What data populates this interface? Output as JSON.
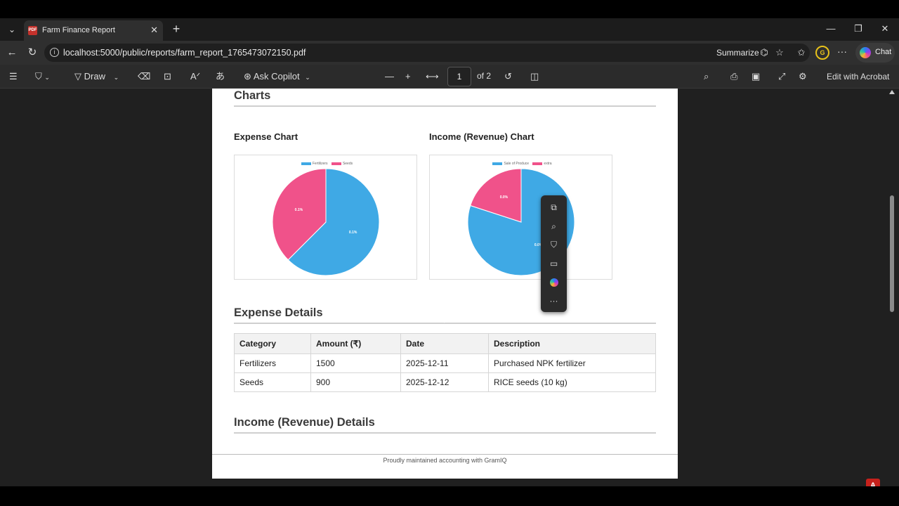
{
  "browser": {
    "tab_title": "Farm Finance Report",
    "favicon_text": "PDF",
    "url": "localhost:5000/public/reports/farm_report_1765473072150.pdf",
    "summarize_label": "Summarize",
    "profile_initials": "G",
    "chat_label": "Chat"
  },
  "pdf_toolbar": {
    "draw_label": "Draw",
    "ask_copilot_label": "Ask Copilot",
    "page_current": "1",
    "page_of": "of 2",
    "edit_acrobat_label": "Edit with Acrobat"
  },
  "report": {
    "charts_heading": "Charts",
    "expense_chart_title": "Expense Chart",
    "income_chart_title": "Income (Revenue) Chart",
    "expense_details_heading": "Expense Details",
    "income_details_heading": "Income (Revenue) Details",
    "footer": "Proudly maintained accounting with GramIQ",
    "table": {
      "headers": [
        "Category",
        "Amount (₹)",
        "Date",
        "Description"
      ],
      "rows": [
        [
          "Fertilizers",
          "1500",
          "2025-12-11",
          "Purchased NPK fertilizer"
        ],
        [
          "Seeds",
          "900",
          "2025-12-12",
          "RICE seeds (10 kg)"
        ]
      ]
    }
  },
  "chart_data": [
    {
      "type": "pie",
      "title": "",
      "categories": [
        "Fertilizers",
        "Seeds"
      ],
      "values": [
        1500,
        900
      ],
      "slice_labels": [
        "0.1%",
        "0.1%"
      ],
      "colors": [
        "#3fa9e5",
        "#f0528a"
      ],
      "legend": "top"
    },
    {
      "type": "pie",
      "title": "",
      "categories": [
        "Sale of Produce",
        "extra"
      ],
      "values": [
        80,
        20
      ],
      "slice_labels": [
        "0.0%",
        "0.0%"
      ],
      "colors": [
        "#3fa9e5",
        "#f0528a"
      ],
      "legend": "top"
    }
  ]
}
